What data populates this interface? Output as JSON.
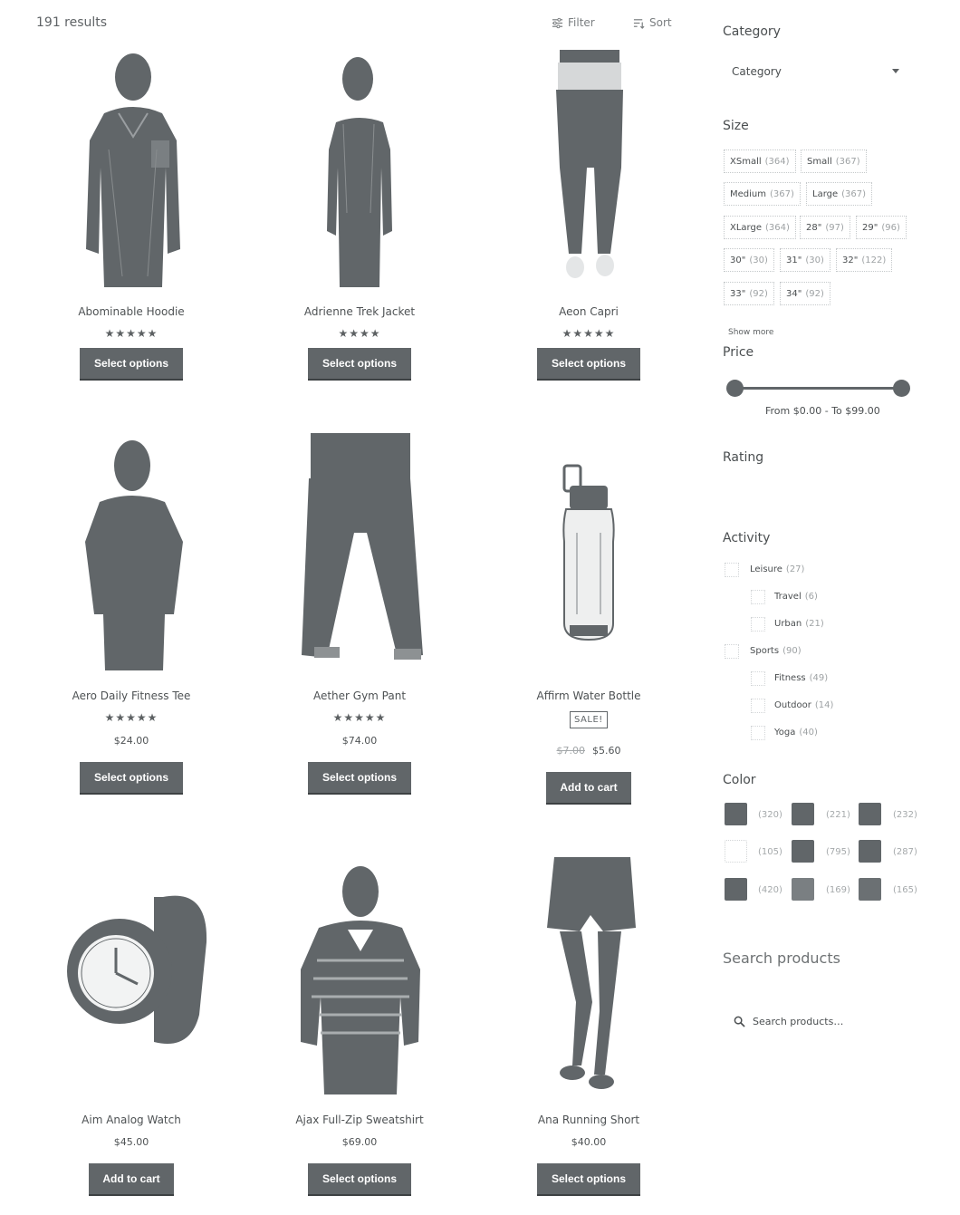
{
  "toolbar": {
    "results": "191 results",
    "filter_label": "Filter",
    "sort_label": "Sort"
  },
  "products": [
    {
      "title": "Abominable Hoodie",
      "stars": "★★★★★",
      "rating": 5,
      "button": "Select options"
    },
    {
      "title": "Adrienne Trek Jacket",
      "stars": "★★★★",
      "rating": 4,
      "button": "Select options"
    },
    {
      "title": "Aeon Capri",
      "stars": "★★★★★",
      "rating": 5,
      "button": "Select options"
    },
    {
      "title": "Aero Daily Fitness Tee",
      "stars": "★★★★★",
      "rating": 5,
      "price": "$24.00",
      "button": "Select options"
    },
    {
      "title": "Aether Gym Pant",
      "stars": "★★★★★",
      "rating": 5,
      "price": "$74.00",
      "button": "Select options"
    },
    {
      "title": "Affirm Water Bottle",
      "badge": "SALE!",
      "old_price": "$7.00",
      "price": "$5.60",
      "button": "Add to cart"
    },
    {
      "title": "Aim Analog Watch",
      "price": "$45.00",
      "button": "Add to cart"
    },
    {
      "title": "Ajax Full-Zip Sweatshirt",
      "price": "$69.00",
      "button": "Select options"
    },
    {
      "title": "Ana Running Short",
      "price": "$40.00",
      "button": "Select options"
    }
  ],
  "sidebar": {
    "category": {
      "heading": "Category",
      "selected": "Category"
    },
    "size": {
      "heading": "Size",
      "chips": [
        {
          "label": "XSmall",
          "count": "(364)"
        },
        {
          "label": "Small",
          "count": "(367)"
        },
        {
          "label": "Medium",
          "count": "(367)"
        },
        {
          "label": "Large",
          "count": "(367)"
        },
        {
          "label": "XLarge",
          "count": "(364)"
        },
        {
          "label": "28\"",
          "count": "(97)"
        },
        {
          "label": "29\"",
          "count": "(96)"
        },
        {
          "label": "30\"",
          "count": "(30)"
        },
        {
          "label": "31\"",
          "count": "(30)"
        },
        {
          "label": "32\"",
          "count": "(122)"
        },
        {
          "label": "33\"",
          "count": "(92)"
        },
        {
          "label": "34\"",
          "count": "(92)"
        }
      ],
      "show_more": "Show more"
    },
    "price": {
      "heading": "Price",
      "range_text": "From $0.00 - To $99.00",
      "min_value": 0,
      "max_value": 99
    },
    "rating": {
      "heading": "Rating"
    },
    "activity": {
      "heading": "Activity",
      "items": [
        {
          "label": "Leisure",
          "count": "(27)"
        },
        {
          "label": "Travel",
          "count": "(6)"
        },
        {
          "label": "Urban",
          "count": "(21)"
        },
        {
          "label": "Sports",
          "count": "(90)"
        },
        {
          "label": "Fitness",
          "count": "(49)"
        },
        {
          "label": "Outdoor",
          "count": "(14)"
        },
        {
          "label": "Yoga",
          "count": "(40)"
        }
      ]
    },
    "color": {
      "heading": "Color",
      "swatches": [
        {
          "count": "(320)",
          "color": "#616669"
        },
        {
          "count": "(221)",
          "color": "#616669"
        },
        {
          "count": "(232)",
          "color": "#616669"
        },
        {
          "count": "(105)",
          "color": "#ffffff"
        },
        {
          "count": "(795)",
          "color": "#616669"
        },
        {
          "count": "(287)",
          "color": "#616669"
        },
        {
          "count": "(420)",
          "color": "#616669"
        },
        {
          "count": "(169)",
          "color": "#7a7f82"
        },
        {
          "count": "(165)",
          "color": "#6b7073"
        }
      ]
    },
    "search": {
      "heading": "Search products",
      "placeholder": "Search products…"
    }
  },
  "colors": {
    "button_bg": "#616669",
    "text": "#4e5254",
    "muted": "#9ea2a4"
  }
}
